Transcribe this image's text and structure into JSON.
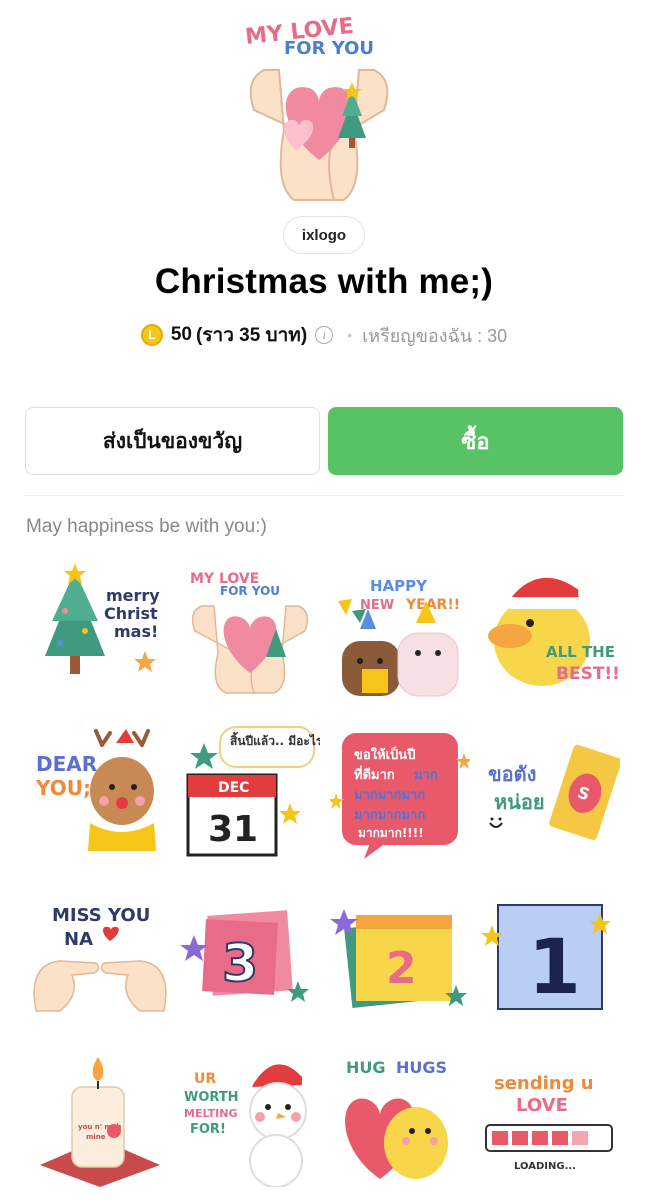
{
  "product": {
    "author": "ixlogo",
    "title": "Christmas with me;)",
    "price_coins": "50",
    "price_thb": "(ราว 35 บาท)",
    "coin_symbol": "L",
    "info_symbol": "i",
    "separator": "•",
    "my_balance": "เหรียญของฉัน : 30"
  },
  "actions": {
    "gift_label": "ส่งเป็นของขวัญ",
    "buy_label": "ซื้อ"
  },
  "description": "May happiness be with you:)",
  "hero": {
    "text_line1": "MY LOVE",
    "text_line2": "FOR YOU"
  },
  "stickers": [
    {
      "icon": "christmas-tree-sticker",
      "text": "merry Christ mas!"
    },
    {
      "icon": "hands-heart-sticker",
      "text": "MY LOVE FOR YOU"
    },
    {
      "icon": "happy-new-year-sticker",
      "text": "HAPPY NEW YEAR!!"
    },
    {
      "icon": "duck-santa-sticker",
      "text": "ALL THE BEST!!"
    },
    {
      "icon": "reindeer-sticker",
      "text": "DEAR YOU;"
    },
    {
      "icon": "calendar-dec-31-sticker",
      "text": "สิ้นปีแล้ว.. มีอะไรจะบอก!",
      "month": "DEC",
      "day": "31"
    },
    {
      "icon": "speech-bubble-wish-sticker",
      "text": "ขอให้เป็นปีที่ดีมากมาก"
    },
    {
      "icon": "red-envelope-sticker",
      "text": "ขอตังหน่อย"
    },
    {
      "icon": "miss-you-hands-sticker",
      "text": "MISS YOU NA"
    },
    {
      "icon": "countdown-3-sticker",
      "text": "3"
    },
    {
      "icon": "countdown-2-sticker",
      "text": "2"
    },
    {
      "icon": "countdown-1-sticker",
      "text": "1"
    },
    {
      "icon": "candle-sticker",
      "text": "you n' mah mine"
    },
    {
      "icon": "snowman-sticker",
      "text": "UR WORTH MELTING FOR!"
    },
    {
      "icon": "hug-hugs-sticker",
      "text": "HUG HUGS"
    },
    {
      "icon": "sending-love-sticker",
      "text": "sending u LOVE",
      "sub": "LOADING..."
    }
  ],
  "colors": {
    "buy_green": "#57c364",
    "coin_yellow": "#f5c518",
    "muted_text": "#888888"
  }
}
